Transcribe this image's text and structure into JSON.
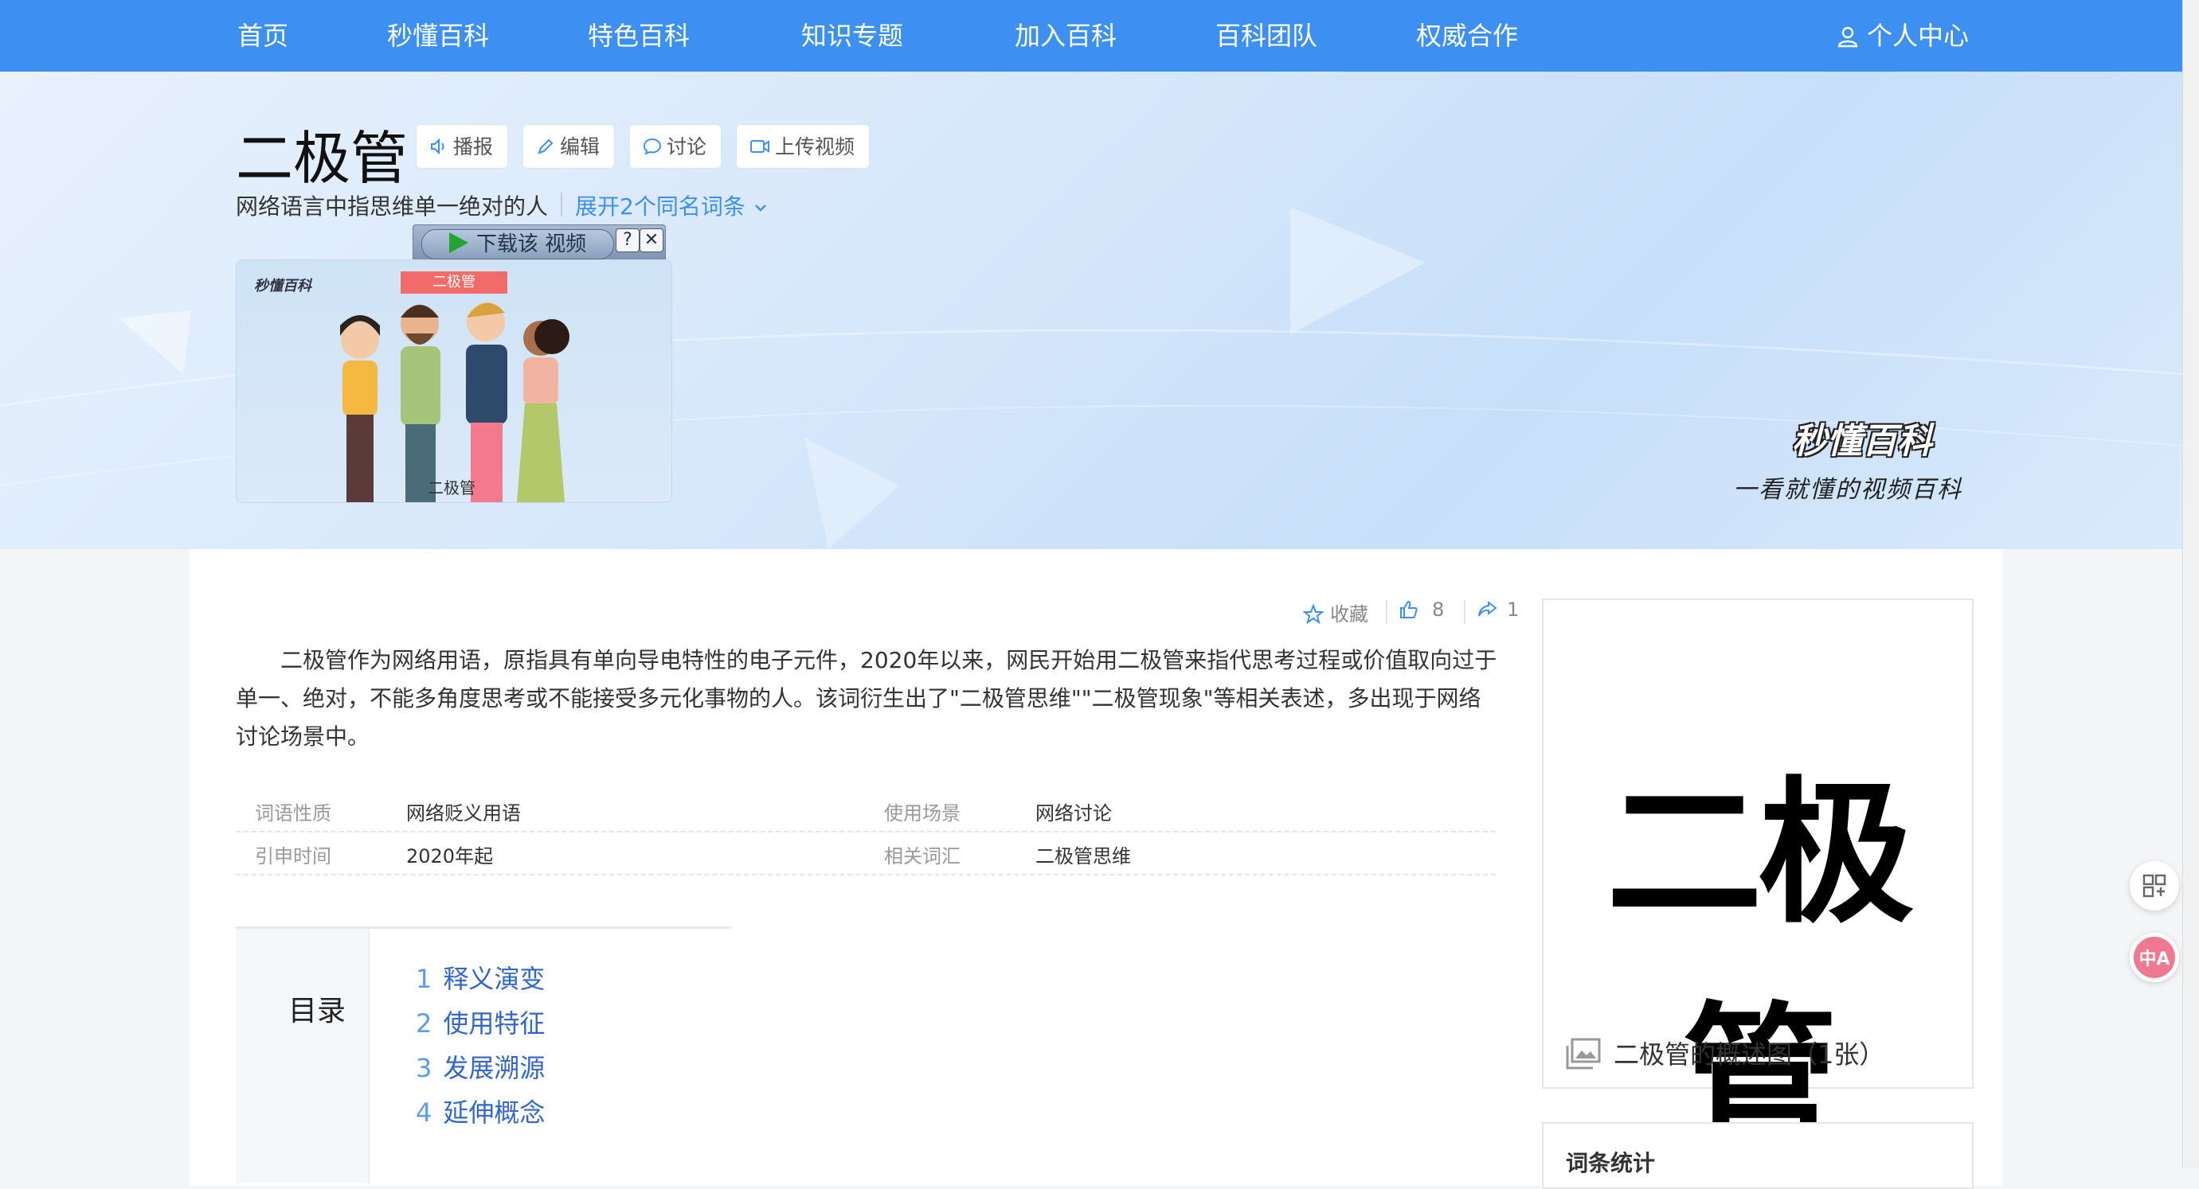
{
  "nav": {
    "items": [
      "首页",
      "秒懂百科",
      "特色百科",
      "知识专题",
      "加入百科",
      "百科团队",
      "权威合作"
    ],
    "user": "个人中心"
  },
  "entry": {
    "title": "二极管",
    "actions": [
      "播报",
      "编辑",
      "讨论",
      "上传视频"
    ],
    "subtitle": "网络语言中指思维单一绝对的人",
    "expand": "展开2个同名词条"
  },
  "video": {
    "download_label": "下载该 视频",
    "help": "?",
    "close": "✕",
    "logo": "秒懂百科",
    "tag": "二极管",
    "caption": "二极管"
  },
  "brand": {
    "logo": "秒懂百科",
    "slogan": "一看就懂的视频百科"
  },
  "stats": {
    "favorite": "收藏",
    "likes": "8",
    "shares": "1"
  },
  "summary": "二极管作为网络用语，原指具有单向导电特性的电子元件，2020年以来，网民开始用二极管来指代思考过程或价值取向过于单一、绝对，不能多角度思考或不能接受多元化事物的人。该词衍生出了\"二极管思维\"\"二极管现象\"等相关表述，多出现于网络讨论场景中。",
  "infobox": [
    {
      "k1": "词语性质",
      "v1": "网络贬义用语",
      "k2": "使用场景",
      "v2": "网络讨论"
    },
    {
      "k1": "引申时间",
      "v1": "2020年起",
      "k2": "相关词汇",
      "v2": "二极管思维"
    }
  ],
  "toc": {
    "title": "目录",
    "items": [
      {
        "num": "1",
        "label": "释义演变"
      },
      {
        "num": "2",
        "label": "使用特征"
      },
      {
        "num": "3",
        "label": "发展溯源"
      },
      {
        "num": "4",
        "label": "延伸概念"
      }
    ]
  },
  "image_card": {
    "text": "二极管",
    "caption": "二极管的概述图（1张）"
  },
  "stat_card": {
    "title": "词条统计"
  },
  "colors": {
    "nav_bg": "#3d8ff2",
    "link": "#3366cc",
    "accent": "#3d8ff2"
  }
}
